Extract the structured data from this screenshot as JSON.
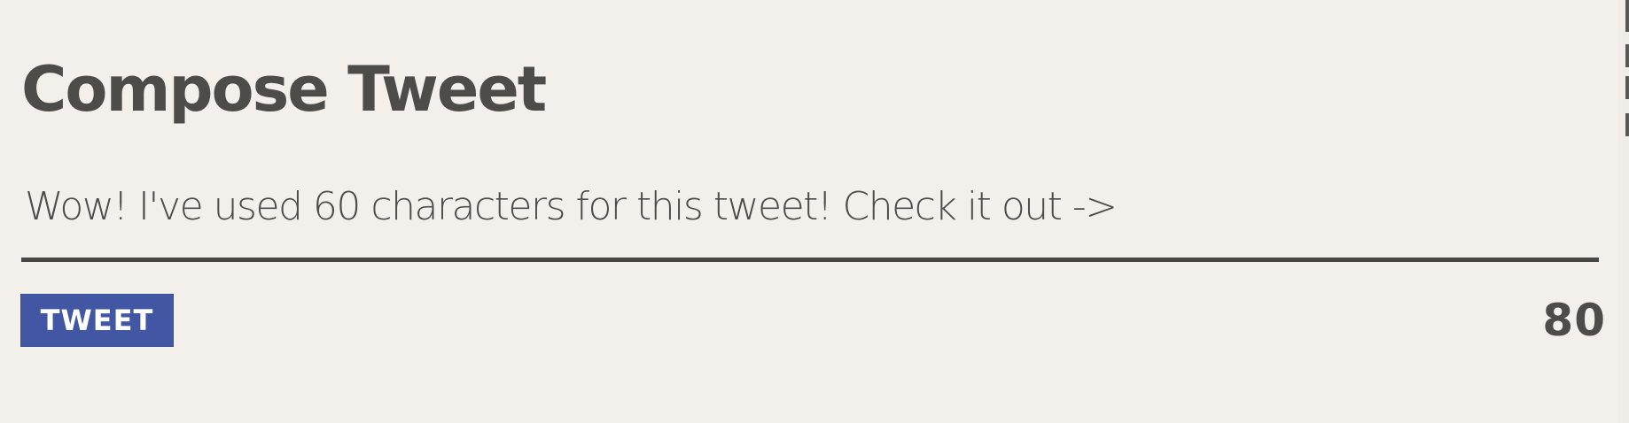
{
  "compose": {
    "title": "Compose Tweet",
    "text": "Wow! I've used 60 characters for this tweet! Check it out ->",
    "button_label": "TWEET",
    "remaining_count": "80"
  },
  "colors": {
    "background": "#f3f0eb",
    "text": "#4e4c48",
    "button": "#4157a4",
    "underline": "#4a4845"
  }
}
